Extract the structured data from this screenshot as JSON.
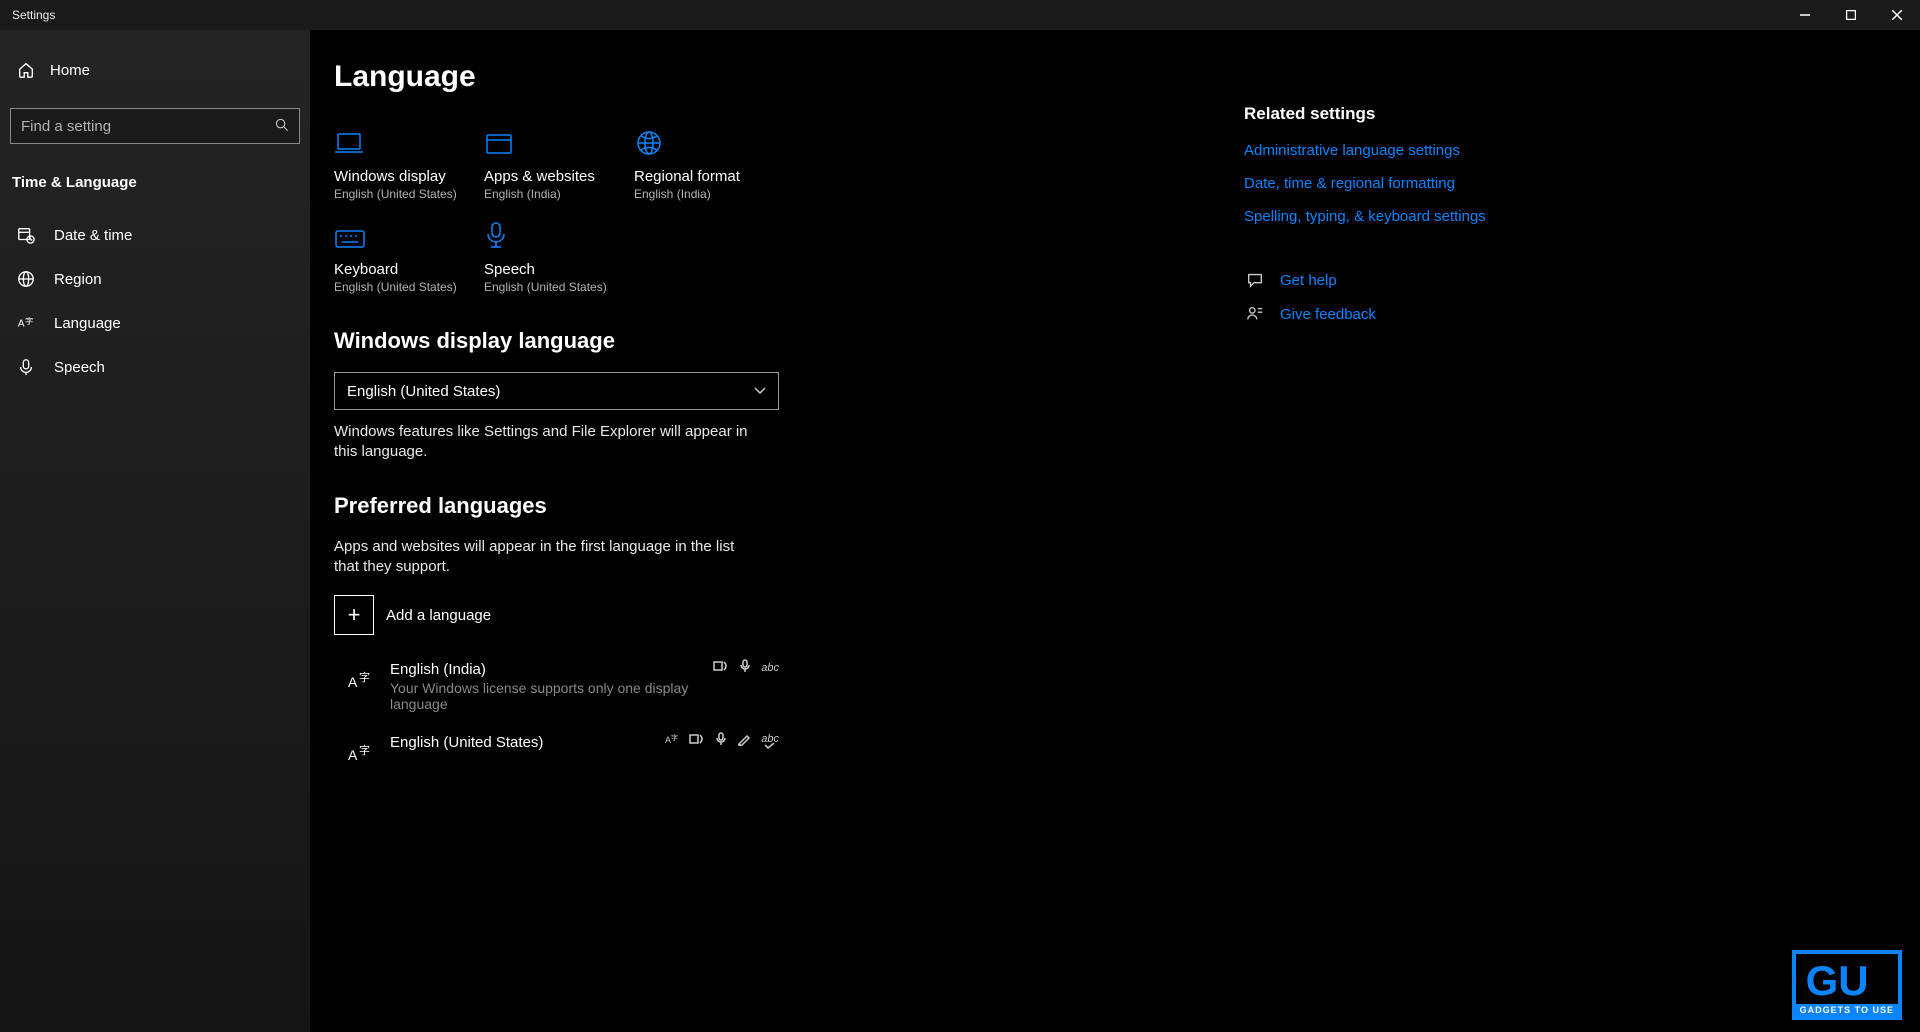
{
  "window": {
    "title": "Settings"
  },
  "sidebar": {
    "home": "Home",
    "search_placeholder": "Find a setting",
    "category": "Time & Language",
    "items": [
      {
        "label": "Date & time"
      },
      {
        "label": "Region"
      },
      {
        "label": "Language"
      },
      {
        "label": "Speech"
      }
    ]
  },
  "header": {
    "title": "Language"
  },
  "tiles": [
    {
      "title": "Windows display",
      "sub": "English (United States)"
    },
    {
      "title": "Apps & websites",
      "sub": "English (India)"
    },
    {
      "title": "Regional format",
      "sub": "English (India)"
    },
    {
      "title": "Keyboard",
      "sub": "English (United States)"
    },
    {
      "title": "Speech",
      "sub": "English (United States)"
    }
  ],
  "display_lang": {
    "heading": "Windows display language",
    "selected": "English (United States)",
    "desc": "Windows features like Settings and File Explorer will appear in this language."
  },
  "preferred": {
    "heading": "Preferred languages",
    "desc": "Apps and websites will appear in the first language in the list that they support.",
    "add_label": "Add a language",
    "items": [
      {
        "name": "English (India)",
        "sub": "Your Windows license supports only one display language"
      },
      {
        "name": "English (United States)",
        "sub": ""
      }
    ]
  },
  "aside": {
    "heading": "Related settings",
    "links": [
      "Administrative language settings",
      "Date, time & regional formatting",
      "Spelling, typing, & keyboard settings"
    ],
    "help": "Get help",
    "feedback": "Give feedback"
  },
  "watermark": {
    "main": "GU",
    "sub": "GADGETS TO USE"
  }
}
